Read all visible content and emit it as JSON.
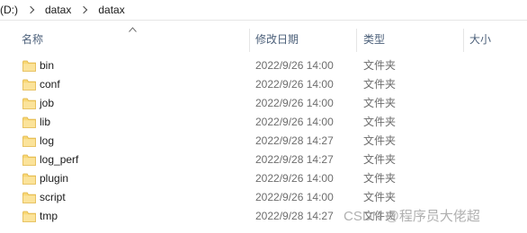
{
  "breadcrumb": [
    "(D:)",
    "datax",
    "datax"
  ],
  "columns": {
    "name": "名称",
    "date": "修改日期",
    "type": "类型",
    "size": "大小"
  },
  "rows": [
    {
      "name": "bin",
      "date": "2022/9/26 14:00",
      "type": "文件夹",
      "size": ""
    },
    {
      "name": "conf",
      "date": "2022/9/26 14:00",
      "type": "文件夹",
      "size": ""
    },
    {
      "name": "job",
      "date": "2022/9/26 14:00",
      "type": "文件夹",
      "size": ""
    },
    {
      "name": "lib",
      "date": "2022/9/26 14:00",
      "type": "文件夹",
      "size": ""
    },
    {
      "name": "log",
      "date": "2022/9/28 14:27",
      "type": "文件夹",
      "size": ""
    },
    {
      "name": "log_perf",
      "date": "2022/9/28 14:27",
      "type": "文件夹",
      "size": ""
    },
    {
      "name": "plugin",
      "date": "2022/9/26 14:00",
      "type": "文件夹",
      "size": ""
    },
    {
      "name": "script",
      "date": "2022/9/26 14:00",
      "type": "文件夹",
      "size": ""
    },
    {
      "name": "tmp",
      "date": "2022/9/28 14:27",
      "type": "文件夹",
      "size": ""
    }
  ],
  "watermark": "CSDN @程序员大佬超",
  "colors": {
    "folder": "#f8d775",
    "folder_dark": "#e0b340",
    "header_text": "#4c607a",
    "secondary_text": "#6d6d6d"
  },
  "icons": {
    "folder": "folder-icon",
    "sort": "sort-ascending-icon",
    "separator": "chevron-right-icon"
  }
}
